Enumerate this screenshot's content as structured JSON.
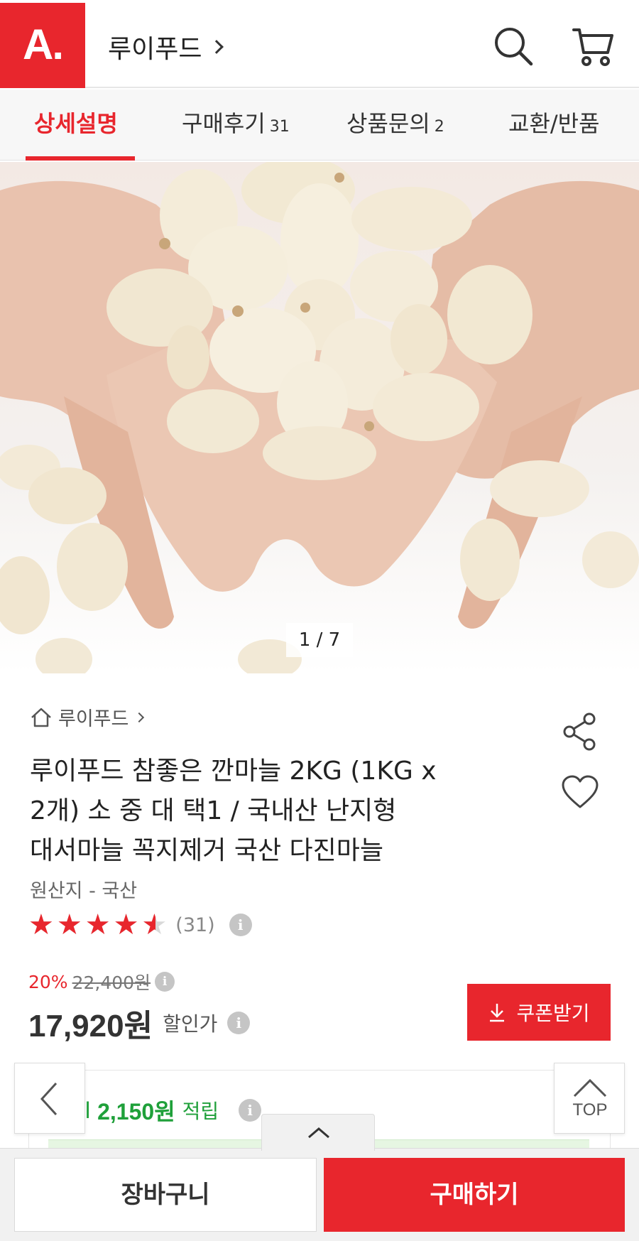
{
  "header": {
    "logo_text": "A.",
    "store_name": "루이푸드",
    "search_icon": "search-icon",
    "cart_icon": "cart-icon"
  },
  "tabs": [
    {
      "label": "상세설명",
      "count": "",
      "active": true
    },
    {
      "label": "구매후기",
      "count": "31",
      "active": false
    },
    {
      "label": "상품문의",
      "count": "2",
      "active": false
    },
    {
      "label": "교환/반품",
      "count": "",
      "active": false
    }
  ],
  "gallery": {
    "counter": "1 / 7"
  },
  "product": {
    "breadcrumb": "루이푸드",
    "title": "루이푸드 참좋은 깐마늘 2KG (1KG x 2개) 소 중 대 택1 / 국내산 난지형 대서마늘 꼭지제거 국산 다진마늘",
    "origin": "원산지 - 국산",
    "rating": 4.5,
    "review_count": "(31)",
    "discount": "20%",
    "original_price": "22,400원",
    "sale_price": "17,920원",
    "sale_label": "할인가",
    "coupon_label": "쿠폰받기",
    "points_value": "2,150원",
    "points_label": "적립",
    "points_prefix": "l"
  },
  "floating": {
    "top_label": "TOP"
  },
  "bottom": {
    "cart_label": "장바구니",
    "buy_label": "구매하기"
  },
  "colors": {
    "accent": "#e8262d",
    "points_green": "#1fa03a"
  }
}
